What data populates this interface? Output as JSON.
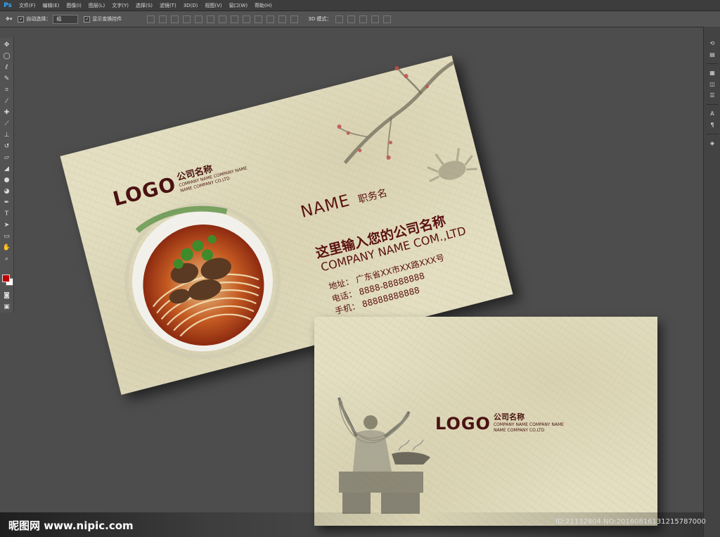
{
  "app": {
    "logo": "Ps"
  },
  "menu": [
    "文件(F)",
    "编辑(E)",
    "图像(I)",
    "图层(L)",
    "文字(Y)",
    "选择(S)",
    "滤镜(T)",
    "3D(D)",
    "视图(V)",
    "窗口(W)",
    "帮助(H)"
  ],
  "options": {
    "auto_select_label": "自动选择：",
    "auto_select_value": "组",
    "show_transform_label": "显示变换控件",
    "mode_3d_label": "3D 模式："
  },
  "front_card": {
    "logo": "LOGO",
    "company_cn": "公司名称",
    "company_en_1": "COMPANY NAME COMPANY NAME",
    "company_en_2": "NAME COMPANY CO.LTD",
    "name": "NAME",
    "title": "职务名",
    "tagline": "这里输入您的公司名称",
    "company_line": "COMPANY NAME COM.,LTD",
    "address": "地址：  广东省XX市XX路XXX号",
    "phone": "电话：  8888-88888888",
    "mobile": "手机：  88888888888"
  },
  "back_card": {
    "logo": "LOGO",
    "company_cn": "公司名称",
    "company_en_1": "COMPANY NAME COMPANY NAME",
    "company_en_2": "NAME COMPANY CO.LTD"
  },
  "watermark": {
    "left": "昵图网 www.nipic.com",
    "right": "ID:21132804 NO:20160816131215787000"
  },
  "colors": {
    "accent_red": "#5a1111",
    "paper": "#e4dfc2",
    "workspace": "#4d4d4d"
  }
}
